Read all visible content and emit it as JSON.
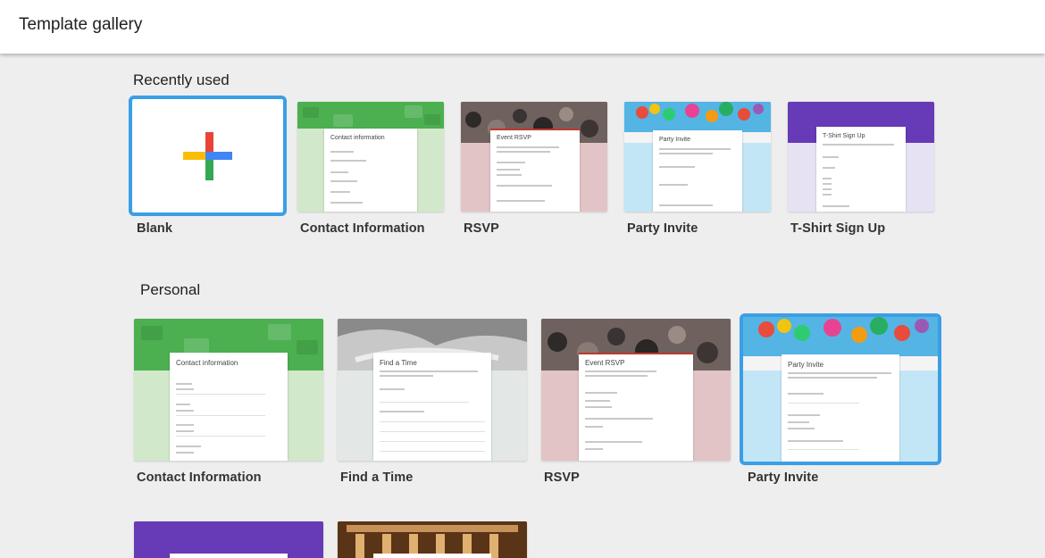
{
  "header": {
    "title": "Template gallery"
  },
  "sections": {
    "recent": {
      "title": "Recently used",
      "cards": [
        {
          "label": "Blank"
        },
        {
          "label": "Contact Information",
          "sheet_title": "Contact information"
        },
        {
          "label": "RSVP",
          "sheet_title": "Event RSVP"
        },
        {
          "label": "Party Invite",
          "sheet_title": "Party Invite"
        },
        {
          "label": "T-Shirt Sign Up",
          "sheet_title": "T-Shirt Sign Up"
        }
      ]
    },
    "personal": {
      "title": "Personal",
      "cards": [
        {
          "label": "Contact Information",
          "sheet_title": "Contact information"
        },
        {
          "label": "Find a Time",
          "sheet_title": "Find a Time"
        },
        {
          "label": "RSVP",
          "sheet_title": "Event RSVP"
        },
        {
          "label": "Party Invite",
          "sheet_title": "Party Invite"
        }
      ]
    }
  },
  "colors": {
    "selection": "#3b9ee6",
    "contact_green": "#4caf50",
    "contact_bg": "#d2e8cb",
    "rsvp_bg": "#e2c4c7",
    "party_bg": "#c2e6f6",
    "tshirt_purple": "#673ab7",
    "tshirt_bg": "#e7e2f3"
  }
}
